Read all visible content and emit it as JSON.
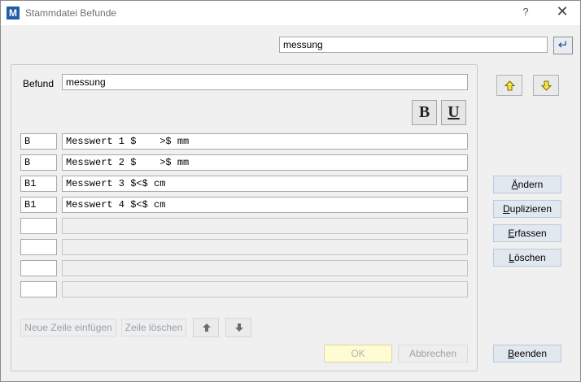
{
  "window": {
    "title": "Stammdatei Befunde",
    "help_label": "?",
    "close_label": "✕",
    "app_icon_text": "M"
  },
  "search": {
    "value": "messung",
    "enter_icon": "↵"
  },
  "befund": {
    "label": "Befund",
    "value": "messung"
  },
  "format": {
    "bold_label": "B",
    "underline_label": "U"
  },
  "rows": [
    {
      "code": "B",
      "text": "Messwert 1 $    >$ mm"
    },
    {
      "code": "B",
      "text": "Messwert 2 $    >$ mm"
    },
    {
      "code": "B1",
      "text": "Messwert 3 $<$ cm"
    },
    {
      "code": "B1",
      "text": "Messwert 4 $<$ cm"
    },
    {
      "code": "",
      "text": ""
    },
    {
      "code": "",
      "text": ""
    },
    {
      "code": "",
      "text": ""
    },
    {
      "code": "",
      "text": ""
    }
  ],
  "actions": {
    "aendern": "Ändern",
    "duplizieren": "Duplizieren",
    "erfassen": "Erfassen",
    "loeschen": "Löschen",
    "beenden": "Beenden"
  },
  "row_tools": {
    "neue_zeile": "Neue Zeile einfügen",
    "zeile_loeschen": "Zeile löschen"
  },
  "dialog": {
    "ok": "OK",
    "abbrechen": "Abbrechen"
  },
  "colors": {
    "up_down_arrow": "#f7e34a",
    "accent": "#1f5fa8"
  }
}
